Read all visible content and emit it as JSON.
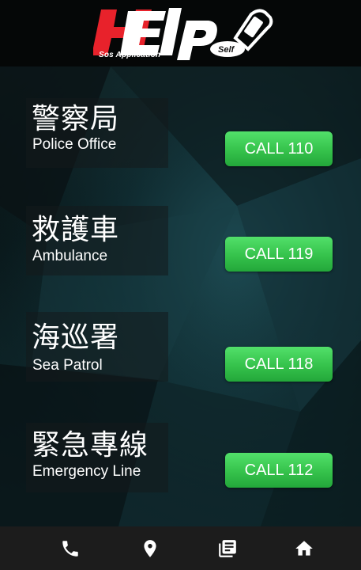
{
  "app": {
    "logo_tagline": "Sos Application"
  },
  "colors": {
    "button": "#35c24b",
    "logo_red": "#e8222b",
    "nav_bg": "#1c1c1c"
  },
  "services": [
    {
      "name_zh": "警察局",
      "name_en": "Police Office",
      "call_label": "CALL 110"
    },
    {
      "name_zh": "救護車",
      "name_en": "Ambulance",
      "call_label": "CALL 119"
    },
    {
      "name_zh": "海巡署",
      "name_en": "Sea Patrol",
      "call_label": "CALL 118"
    },
    {
      "name_zh": "緊急專線",
      "name_en": "Emergency Line",
      "call_label": "CALL 112"
    }
  ],
  "bottom_nav": {
    "items": [
      {
        "icon": "phone-icon"
      },
      {
        "icon": "location-pin-icon"
      },
      {
        "icon": "list-icon"
      },
      {
        "icon": "home-icon"
      }
    ]
  }
}
